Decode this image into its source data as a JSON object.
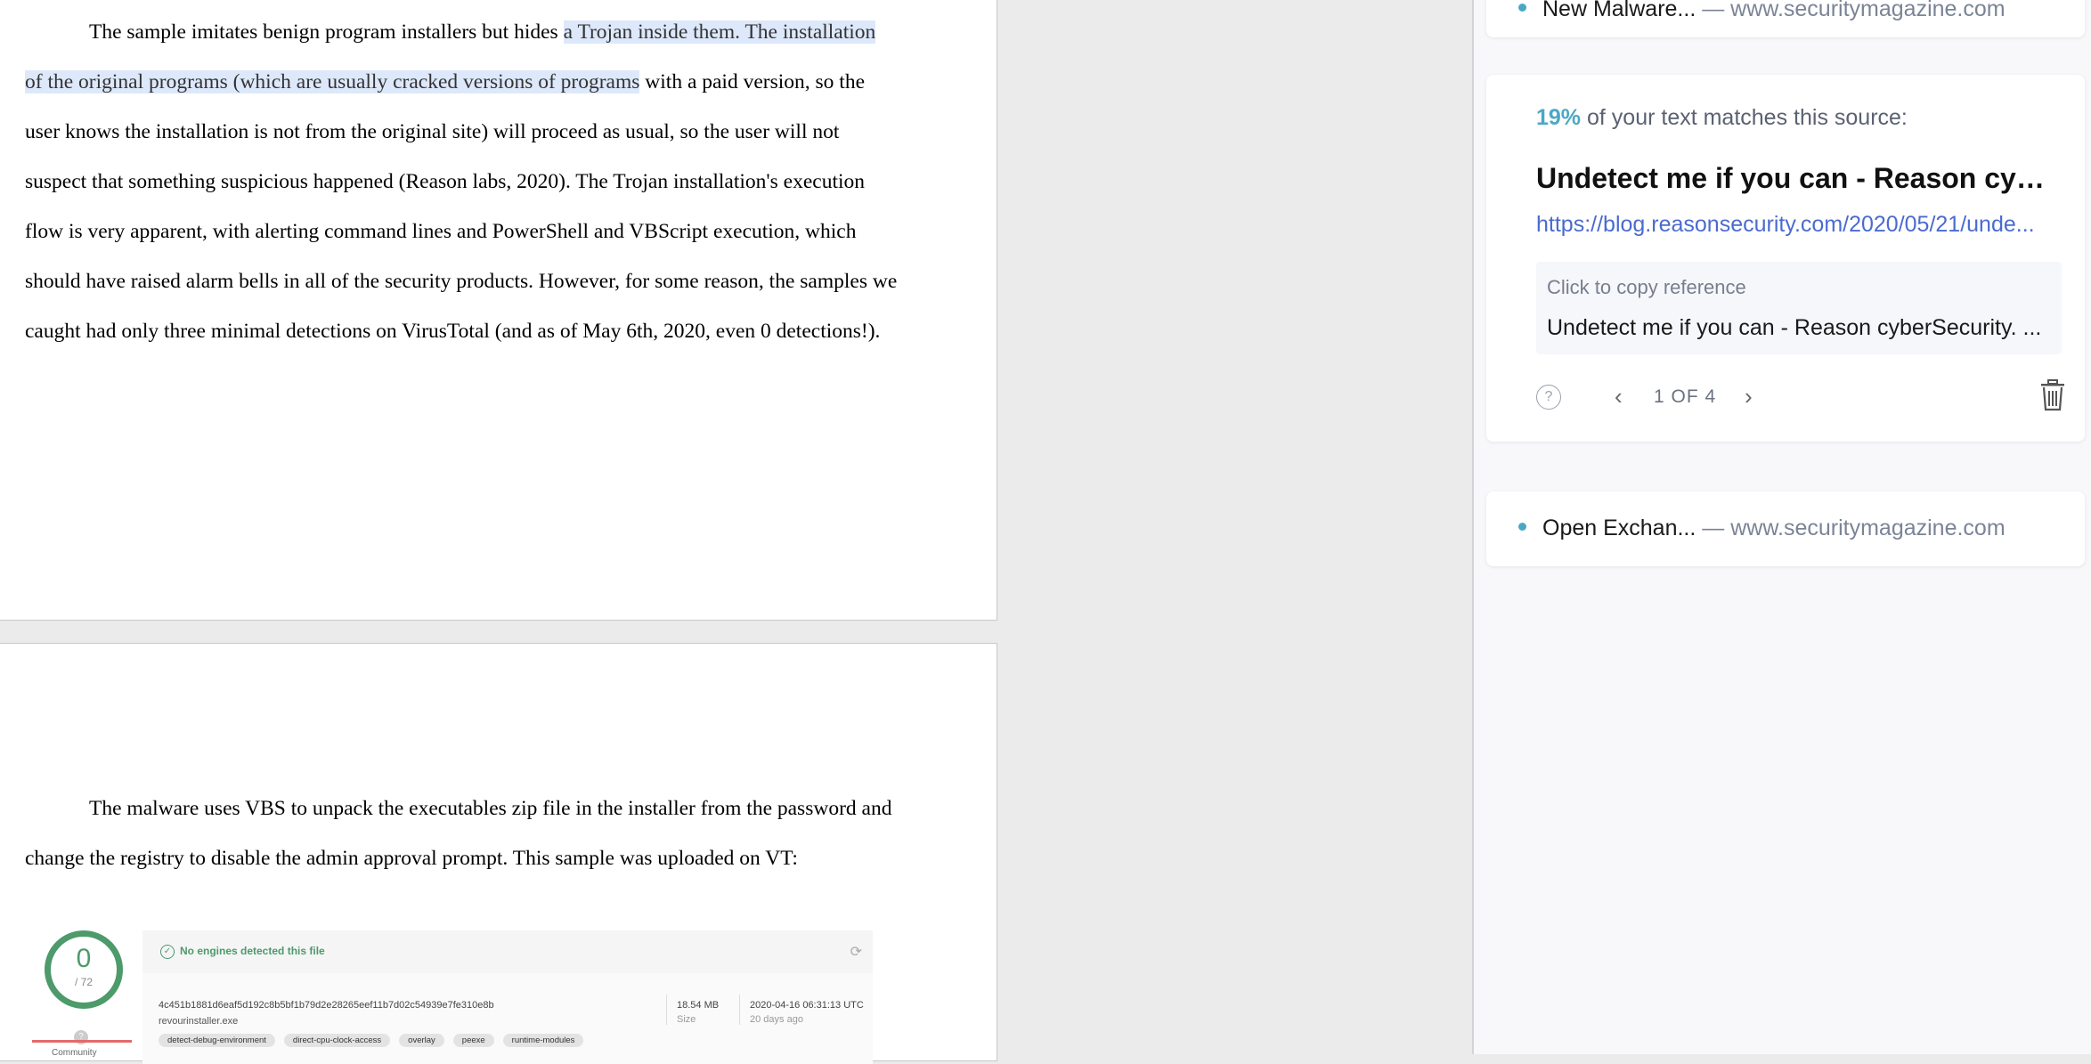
{
  "document": {
    "page1": {
      "para_before_highlight": "The sample imitates benign program installers but hides ",
      "highlight": "a Trojan inside them. The installation of the original programs (which are usually cracked versions of programs",
      "para_after_highlight": " with a paid version, so the user knows the installation is not from the original site) will proceed as usual, so the user will not suspect that something suspicious happened (Reason labs, 2020). The Trojan installation's execution flow is very apparent, with alerting command lines and PowerShell and VBScript execution, which should have raised alarm bells in all of the security products. However, for some reason, the samples we caught had only three minimal detections on VirusTotal (and as of May 6th, 2020, even 0 detections!)."
    },
    "page2": {
      "paragraph": "The malware uses VBS to unpack the executables zip file in the installer from the password and change the registry to disable the admin approval prompt. This sample was uploaded on VT:"
    },
    "vt_screenshot": {
      "score": "0",
      "total": "/ 72",
      "no_engines": "No engines detected this file",
      "hash": "4c451b1881d6eaf5d192c8b5bf1b79d2e28265eef11b7d02c54939e7fe310e8b",
      "filename": "revourinstaller.exe",
      "size": "18.54 MB",
      "size_label": "Size",
      "date": "2020-04-16 06:31:13 UTC",
      "ago": "20 days ago",
      "community": "Community",
      "tags": [
        "detect-debug-environment",
        "direct-cpu-clock-access",
        "overlay",
        "peexe",
        "runtime-modules"
      ],
      "colors": {
        "accent": "#4d9a6b"
      }
    }
  },
  "sidebar": {
    "top_item": {
      "title": "New Malware...",
      "domain": "— www.securitymagazine.com"
    },
    "match": {
      "percent": "19%",
      "text": " of your text matches this source:",
      "title": "Undetect me if you can - Reason cybe...",
      "url": "https://blog.reasonsecurity.com/2020/05/21/unde...",
      "ref_label": "Click to copy reference",
      "ref_text": "Undetect me if you can - Reason cyberSecurity. ...",
      "help": "?",
      "pager": "1 OF 4"
    },
    "bottom_item": {
      "title": "Open Exchan...",
      "domain": "— www.securitymagazine.com"
    },
    "colors": {
      "accent": "#4aa8c4",
      "link": "#4a6bd0"
    }
  }
}
